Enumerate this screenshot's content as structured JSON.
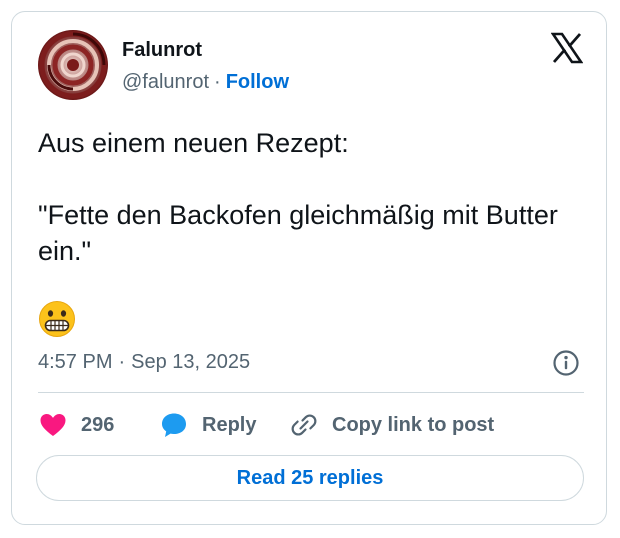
{
  "author": {
    "display_name": "Falunrot",
    "handle": "@falunrot",
    "separator": "·",
    "follow_label": "Follow"
  },
  "post": {
    "line1": "Aus einem neuen Rezept:",
    "line2": "\"Fette den Backofen gleichmäßig mit Butter ein.\"",
    "emoji": "grimacing-face"
  },
  "meta": {
    "time": "4:57 PM",
    "separator": "·",
    "date": "Sep 13, 2025"
  },
  "actions": {
    "like_count": "296",
    "reply_label": "Reply",
    "copy_link_label": "Copy link to post"
  },
  "footer": {
    "read_replies_label": "Read 25 replies"
  },
  "icons": {
    "brand": "x-logo-icon",
    "like": "heart-icon",
    "reply": "speech-bubble-icon",
    "copy": "link-icon",
    "info": "info-icon"
  },
  "colors": {
    "link_blue": "#006fd6",
    "heart_pink": "#f91880",
    "reply_blue": "#1d9bf0",
    "muted_text": "#536471",
    "border": "#cfd9de"
  }
}
